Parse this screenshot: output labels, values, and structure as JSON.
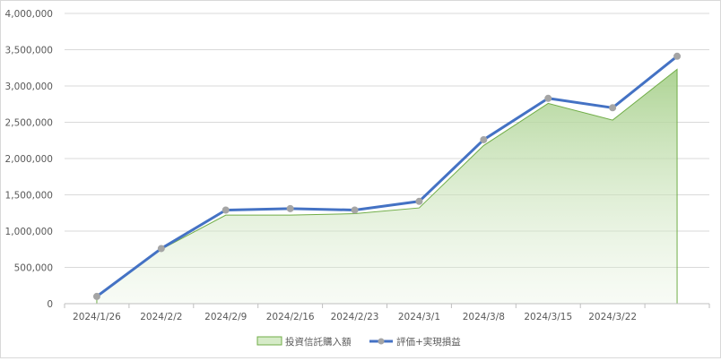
{
  "chart_data": {
    "type": "area",
    "categories": [
      "2024/1/26",
      "2024/2/2",
      "2024/2/9",
      "2024/2/16",
      "2024/2/23",
      "2024/3/1",
      "2024/3/8",
      "2024/3/15",
      "2024/3/22",
      ""
    ],
    "y_ticks": [
      "0",
      "500,000",
      "1,000,000",
      "1,500,000",
      "2,000,000",
      "2,500,000",
      "3,000,000",
      "3,500,000",
      "4,000,000"
    ],
    "ylim": [
      0,
      4000000
    ],
    "grid": true,
    "legend_position": "bottom",
    "series": [
      {
        "name": "投資信託購入額",
        "type": "area",
        "color": "#70ad47",
        "values": [
          100000,
          750000,
          1220000,
          1220000,
          1240000,
          1320000,
          2180000,
          2760000,
          2530000,
          3230000
        ]
      },
      {
        "name": "評価+実現損益",
        "type": "line",
        "color": "#4472c4",
        "marker_color": "#a5a5a5",
        "values": [
          100000,
          760000,
          1290000,
          1310000,
          1290000,
          1410000,
          2260000,
          2830000,
          2700000,
          3410000
        ]
      }
    ]
  }
}
